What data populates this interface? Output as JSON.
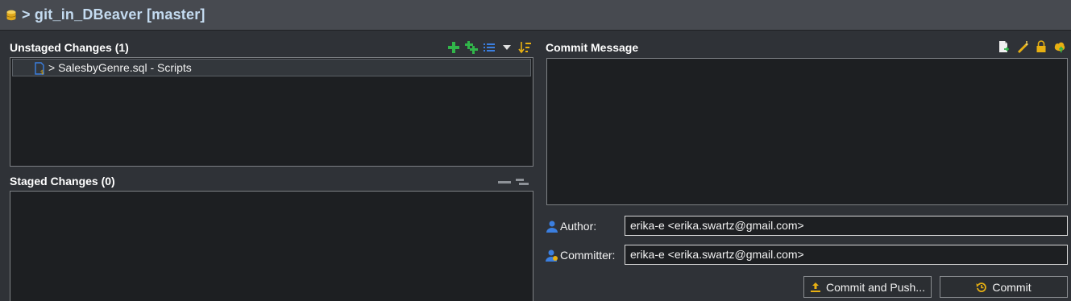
{
  "title": {
    "text": "> git_in_DBeaver [master]",
    "icon": "database-icon"
  },
  "unstaged": {
    "header": "Unstaged Changes (1)",
    "toolbar": [
      "add-to-index-icon",
      "add-all-to-index-icon",
      "list-view-icon",
      "view-menu-icon",
      "sort-icon"
    ],
    "items": [
      {
        "icon": "sql-script-file-icon",
        "label": "> SalesbyGenre.sql - Scripts"
      }
    ]
  },
  "staged": {
    "header": "Staged Changes (0)",
    "toolbar": [
      "collapse-all-icon",
      "presentation-icon"
    ]
  },
  "commit_message": {
    "header": "Commit Message",
    "value": "",
    "toolbar": [
      "add-signed-off-by-icon",
      "amend-icon",
      "sign-commit-icon",
      "push-icon"
    ]
  },
  "author": {
    "label": "Author:",
    "value": "erika-e <erika.swartz@gmail.com>",
    "icon": "author-icon"
  },
  "committer": {
    "label": "Committer:",
    "value": "erika-e <erika.swartz@gmail.com>",
    "icon": "committer-icon"
  },
  "buttons": {
    "commit_and_push": "Commit and Push...",
    "commit": "Commit"
  },
  "colors": {
    "title": "#c4dbf0",
    "panel_bg": "#2f3237",
    "box_bg": "#1d1f22",
    "green_action": "#31b54a",
    "blue_action": "#3b7fe0",
    "gold_action": "#e8b012"
  }
}
